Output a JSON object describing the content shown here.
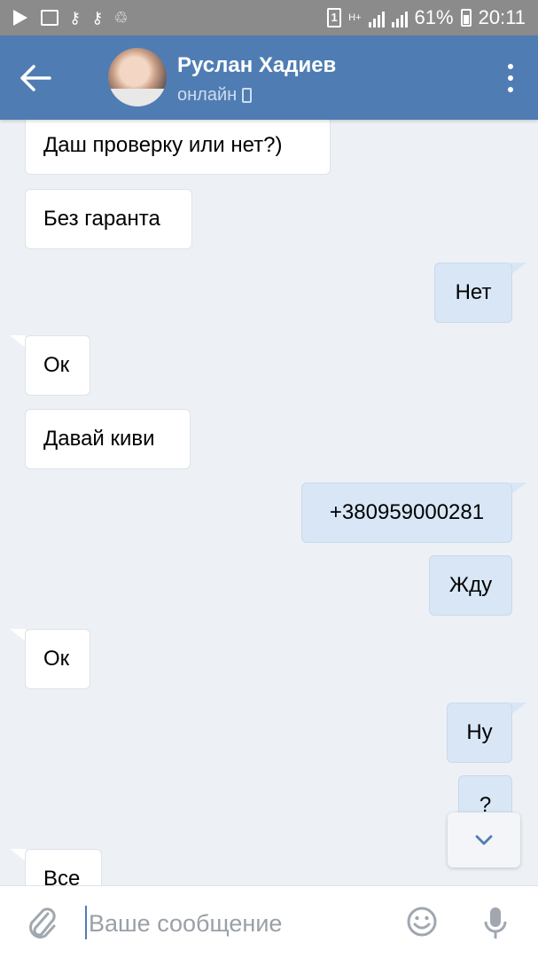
{
  "status_bar": {
    "battery_percent": "61%",
    "time": "20:11",
    "sim_number": "1",
    "network_label": "H+"
  },
  "header": {
    "contact_name": "Руслан Хадиев",
    "status": "онлайн"
  },
  "messages": [
    {
      "direction": "in",
      "text": "Даш проверку или нет?)"
    },
    {
      "direction": "in",
      "text": "Без гаранта"
    },
    {
      "direction": "out",
      "text": "Нет"
    },
    {
      "direction": "in",
      "text": "Ок"
    },
    {
      "direction": "in",
      "text": "Давай киви"
    },
    {
      "direction": "out",
      "text": "+380959000281"
    },
    {
      "direction": "out",
      "text": "Жду"
    },
    {
      "direction": "in",
      "text": "Ок"
    },
    {
      "direction": "out",
      "text": "Ну"
    },
    {
      "direction": "out",
      "text": "?"
    },
    {
      "direction": "in",
      "text": "Все"
    }
  ],
  "composer": {
    "placeholder": "Ваше сообщение"
  },
  "colors": {
    "header": "#4f7db3",
    "background": "#edf1f5",
    "incoming_bubble": "#ffffff",
    "outgoing_bubble": "#d8e6f6"
  },
  "icons": [
    "back-arrow-icon",
    "more-vert-icon",
    "phone-icon",
    "chevron-down-icon",
    "attach-icon",
    "emoji-icon",
    "microphone-icon"
  ]
}
